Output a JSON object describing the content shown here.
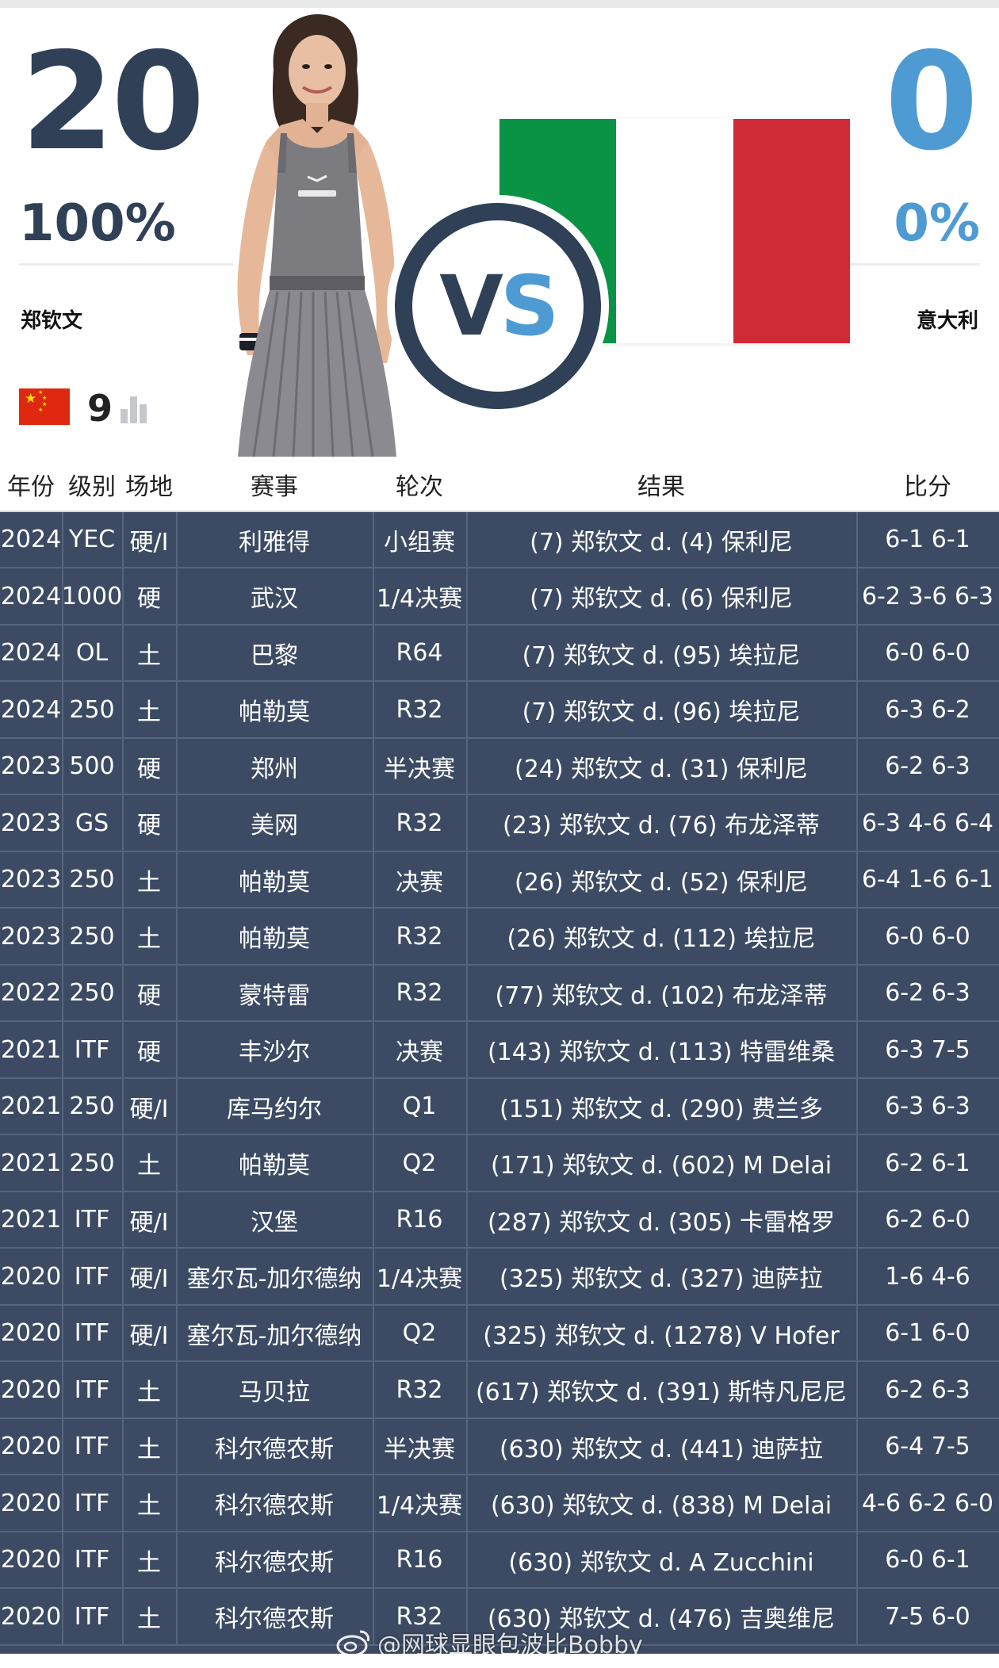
{
  "header": {
    "left_score": "20",
    "right_score": "0",
    "left_pct": "100%",
    "right_pct": "0%",
    "left_name": "郑钦文",
    "right_name": "意大利",
    "left_rank": "9",
    "vs_v": "V",
    "vs_s": "S",
    "colors": {
      "dark": "#2f4057",
      "accent": "#4e9bd4",
      "italy_green": "#0a9345",
      "italy_white": "#ffffff",
      "italy_red": "#ce2b37",
      "china_red": "#de2910"
    }
  },
  "table": {
    "headers": {
      "year": "年份",
      "level": "级别",
      "surface": "场地",
      "event": "赛事",
      "round": "轮次",
      "result": "结果",
      "score": "比分"
    },
    "rows": [
      {
        "year": "2024",
        "level": "YEC",
        "surface": "硬/I",
        "event": "利雅得",
        "round": "小组赛",
        "result": "(7) 郑钦文 d. (4) 保利尼",
        "score": "6-1 6-1"
      },
      {
        "year": "2024",
        "level": "1000",
        "surface": "硬",
        "event": "武汉",
        "round": "1/4决赛",
        "result": "(7) 郑钦文 d. (6) 保利尼",
        "score": "6-2 3-6 6-3"
      },
      {
        "year": "2024",
        "level": "OL",
        "surface": "土",
        "event": "巴黎",
        "round": "R64",
        "result": "(7) 郑钦文 d. (95) 埃拉尼",
        "score": "6-0 6-0"
      },
      {
        "year": "2024",
        "level": "250",
        "surface": "土",
        "event": "帕勒莫",
        "round": "R32",
        "result": "(7) 郑钦文 d. (96) 埃拉尼",
        "score": "6-3 6-2"
      },
      {
        "year": "2023",
        "level": "500",
        "surface": "硬",
        "event": "郑州",
        "round": "半决赛",
        "result": "(24) 郑钦文 d. (31) 保利尼",
        "score": "6-2 6-3"
      },
      {
        "year": "2023",
        "level": "GS",
        "surface": "硬",
        "event": "美网",
        "round": "R32",
        "result": "(23) 郑钦文 d. (76) 布龙泽蒂",
        "score": "6-3 4-6 6-4"
      },
      {
        "year": "2023",
        "level": "250",
        "surface": "土",
        "event": "帕勒莫",
        "round": "决赛",
        "result": "(26) 郑钦文 d. (52) 保利尼",
        "score": "6-4 1-6 6-1"
      },
      {
        "year": "2023",
        "level": "250",
        "surface": "土",
        "event": "帕勒莫",
        "round": "R32",
        "result": "(26) 郑钦文 d. (112) 埃拉尼",
        "score": "6-0 6-0"
      },
      {
        "year": "2022",
        "level": "250",
        "surface": "硬",
        "event": "蒙特雷",
        "round": "R32",
        "result": "(77) 郑钦文 d. (102) 布龙泽蒂",
        "score": "6-2 6-3"
      },
      {
        "year": "2021",
        "level": "ITF",
        "surface": "硬",
        "event": "丰沙尔",
        "round": "决赛",
        "result": "(143) 郑钦文 d. (113) 特雷维桑",
        "score": "6-3 7-5"
      },
      {
        "year": "2021",
        "level": "250",
        "surface": "硬/I",
        "event": "库马约尔",
        "round": "Q1",
        "result": "(151) 郑钦文 d. (290) 费兰多",
        "score": "6-3 6-3"
      },
      {
        "year": "2021",
        "level": "250",
        "surface": "土",
        "event": "帕勒莫",
        "round": "Q2",
        "result": "(171) 郑钦文 d. (602) M Delai",
        "score": "6-2 6-1"
      },
      {
        "year": "2021",
        "level": "ITF",
        "surface": "硬/I",
        "event": "汉堡",
        "round": "R16",
        "result": "(287) 郑钦文 d. (305) 卡雷格罗",
        "score": "6-2 6-0"
      },
      {
        "year": "2020",
        "level": "ITF",
        "surface": "硬/I",
        "event": "塞尔瓦-加尔德纳",
        "round": "1/4决赛",
        "result": "(325) 郑钦文 d. (327) 迪萨拉",
        "score": "1-6 4-6"
      },
      {
        "year": "2020",
        "level": "ITF",
        "surface": "硬/I",
        "event": "塞尔瓦-加尔德纳",
        "round": "Q2",
        "result": "(325) 郑钦文 d. (1278) V Hofer",
        "score": "6-1 6-0"
      },
      {
        "year": "2020",
        "level": "ITF",
        "surface": "土",
        "event": "马贝拉",
        "round": "R32",
        "result": "(617) 郑钦文 d. (391) 斯特凡尼尼",
        "score": "6-2 6-3"
      },
      {
        "year": "2020",
        "level": "ITF",
        "surface": "土",
        "event": "科尔德农斯",
        "round": "半决赛",
        "result": "(630) 郑钦文 d. (441) 迪萨拉",
        "score": "6-4 7-5"
      },
      {
        "year": "2020",
        "level": "ITF",
        "surface": "土",
        "event": "科尔德农斯",
        "round": "1/4决赛",
        "result": "(630) 郑钦文 d. (838) M Delai",
        "score": "4-6 6-2 6-0"
      },
      {
        "year": "2020",
        "level": "ITF",
        "surface": "土",
        "event": "科尔德农斯",
        "round": "R16",
        "result": "(630) 郑钦文 d. A Zucchini",
        "score": "6-0 6-1"
      },
      {
        "year": "2020",
        "level": "ITF",
        "surface": "土",
        "event": "科尔德农斯",
        "round": "R32",
        "result": "(630) 郑钦文 d. (476) 吉奥维尼",
        "score": "7-5 6-0"
      }
    ]
  },
  "watermark": "@网球显眼包波比Bobby"
}
